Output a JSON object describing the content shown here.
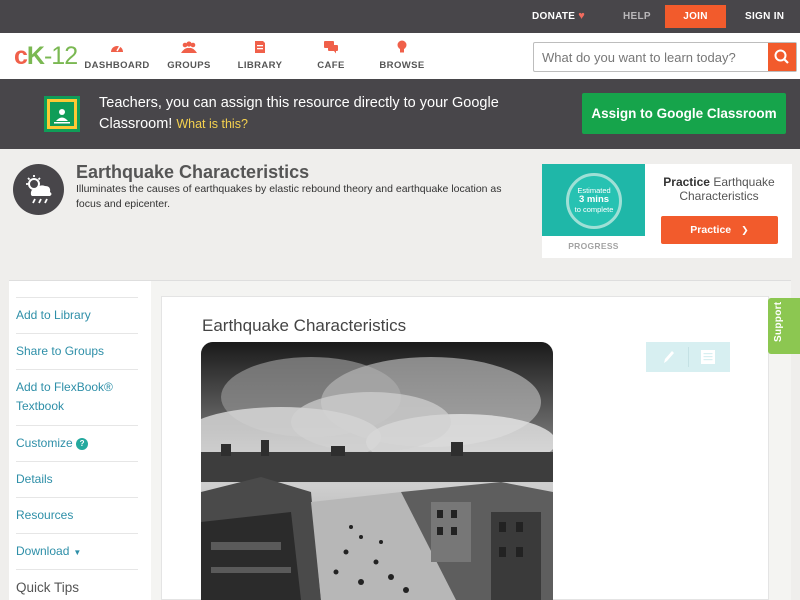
{
  "topbar": {
    "donate": "DONATE",
    "help": "HELP",
    "join": "JOIN",
    "signin": "SIGN IN"
  },
  "header": {
    "logo_c": "c",
    "logo_k": "K",
    "logo_dash": "-",
    "logo_num": "12",
    "nav": [
      {
        "label": "DASHBOARD",
        "icon": "dashboard-gauge-icon"
      },
      {
        "label": "GROUPS",
        "icon": "groups-people-icon"
      },
      {
        "label": "LIBRARY",
        "icon": "library-book-icon"
      },
      {
        "label": "CAFE",
        "icon": "cafe-chat-icon"
      },
      {
        "label": "BROWSE",
        "icon": "browse-lightbulb-icon"
      }
    ],
    "search_placeholder": "What do you want to learn today?"
  },
  "banner": {
    "message": "Teachers, you can assign this resource directly to your Google Classroom!",
    "what_link": "What is this?",
    "assign_button": "Assign to Google Classroom"
  },
  "resource": {
    "title": "Earthquake Characteristics",
    "description": "Illuminates the causes of earthquakes by elastic rebound theory and earthquake location as focus and epicenter."
  },
  "practice": {
    "estimate_line1": "Estimated",
    "estimate_line2": "3 mins",
    "estimate_line3": "to complete",
    "progress_label": "PROGRESS",
    "title_bold": "Practice",
    "title_rest": "Earthquake Characteristics",
    "button": "Practice"
  },
  "sidebar": {
    "items": [
      {
        "label": "Add to Library"
      },
      {
        "label": "Share to Groups"
      },
      {
        "label": "Add to FlexBook® Textbook"
      },
      {
        "label": "Customize"
      },
      {
        "label": "Details"
      },
      {
        "label": "Resources"
      },
      {
        "label": "Download"
      }
    ],
    "quick_tips": "Quick Tips"
  },
  "content": {
    "title": "Earthquake Characteristics"
  },
  "support": "Support",
  "colors": {
    "accent_orange": "#f25b2c",
    "google_green": "#16a44b",
    "link_teal": "#2e8fa8",
    "support_green": "#8cc751"
  }
}
